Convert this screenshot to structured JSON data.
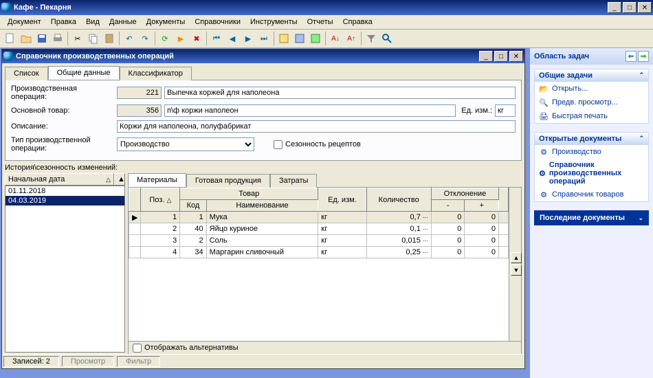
{
  "window_title": "Кафе - Пекарня",
  "menu": [
    "Документ",
    "Правка",
    "Вид",
    "Данные",
    "Документы",
    "Справочники",
    "Инструменты",
    "Отчеты",
    "Справка"
  ],
  "mdi_title": "Справочник производственных операций",
  "tabs_top": [
    "Список",
    "Общие данные",
    "Классификатор"
  ],
  "active_top_tab": 1,
  "form": {
    "op_label": "Производственная операция:",
    "op_id": "221",
    "op_name": "Выпечка коржей для наполеона",
    "product_label": "Основной товар:",
    "product_id": "356",
    "product_name": "п\\ф коржи наполеон",
    "uom_label": "Ед. изм.:",
    "uom": "кг",
    "desc_label": "Описание:",
    "desc": "Коржи для наполеона, полуфабрикат",
    "type_label": "Тип производственной операции:",
    "type": "Производство",
    "season_label": "Сезонность рецептов"
  },
  "history": {
    "label": "История\\сезонность изменений:",
    "col": "Начальная дата",
    "rows": [
      "01.11.2018",
      "04.03.2019"
    ],
    "selected": 1
  },
  "inner_tabs": [
    "Материалы",
    "Готовая продукция",
    "Затраты"
  ],
  "active_inner_tab": 0,
  "materials": {
    "headers": {
      "pos": "Поз.",
      "product": "Товар",
      "code": "Код",
      "name": "Наименование",
      "uom": "Ед. изм.",
      "qty": "Количество",
      "dev": "Отклонение",
      "minus": "-",
      "plus": "+"
    },
    "rows": [
      {
        "pos": "1",
        "code": "1",
        "name": "Мука",
        "uom": "кг",
        "qty": "0,7",
        "minus": "0",
        "plus": "0",
        "sel": true
      },
      {
        "pos": "2",
        "code": "40",
        "name": "Яйцо куриное",
        "uom": "кг",
        "qty": "0,1",
        "minus": "0",
        "plus": "0"
      },
      {
        "pos": "3",
        "code": "2",
        "name": "Соль",
        "uom": "кг",
        "qty": "0,015",
        "minus": "0",
        "plus": "0"
      },
      {
        "pos": "4",
        "code": "34",
        "name": "Маргарин сливочный",
        "uom": "кг",
        "qty": "0,25",
        "minus": "0",
        "plus": "0"
      }
    ],
    "alt_label": "Отображать альтернативы"
  },
  "status": {
    "records_label": "Записей:",
    "records": "2",
    "view": "Просмотр",
    "filter": "Фильтр"
  },
  "taskpane": {
    "title": "Область задач",
    "s1_title": "Общие задачи",
    "s1_links": [
      "Открыть...",
      "Предв. просмотр...",
      "Быстрая печать"
    ],
    "s2_title": "Открытые документы",
    "s2_links": [
      "Производство",
      "Справочник производственных операций",
      "Справочник товаров"
    ],
    "s2_active": 1,
    "recent": "Последние документы"
  }
}
